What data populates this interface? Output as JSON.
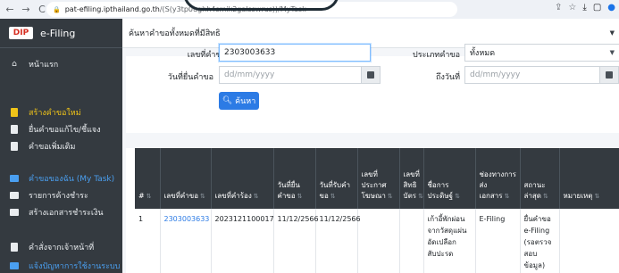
{
  "browser": {
    "url_host": "pat-efiling.ipthailand.go.th",
    "url_path": "/(S(y3tp0ughh4smik2galsswrus))/MyTask"
  },
  "sidebar": {
    "brand_logo": "DIP",
    "brand": "e-Filing",
    "items": [
      {
        "label": "หน้าแรก",
        "icon": "home-icon"
      },
      {
        "label": "สร้างคำขอใหม่",
        "icon": "document-icon"
      },
      {
        "label": "ยื่นคำขอแก้ไข/ชี้แจง",
        "icon": "document-icon"
      },
      {
        "label": "คำขอเพิ่มเติม",
        "icon": "document-icon"
      },
      {
        "label": "คำขอของฉัน (My Task)",
        "icon": "folder-icon"
      },
      {
        "label": "รายการค้างชำระ",
        "icon": "card-icon"
      },
      {
        "label": "สร้างเอกสารชำระเงิน",
        "icon": "card-icon"
      },
      {
        "label": "คำสั่งจากเจ้าหน้าที่",
        "icon": "document-icon"
      },
      {
        "label": "แจ้งปัญหาการใช้งานระบบ",
        "icon": "folder-icon"
      }
    ]
  },
  "page": {
    "title": "ค้นหาคำขอทั้งหมดที่มีสิทธิ"
  },
  "search": {
    "request_no_label": "เลขที่คำขอ",
    "request_no_value": "2303003633",
    "type_label": "ประเภทคำขอ",
    "type_value": "ทั้งหมด",
    "date_from_label": "วันที่ยื่นคำขอ",
    "date_from_placeholder": "dd/mm/yyyy",
    "date_to_label": "ถึงวันที่",
    "date_to_placeholder": "dd/mm/yyyy",
    "search_button": "ค้นหา"
  },
  "table": {
    "headers": [
      "#",
      "เลขที่คำขอ",
      "เลขที่คำร้อง",
      "วันที่ยื่นคำขอ",
      "วันที่รับคำขอ",
      "เลขที่ประกาศโฆษณา",
      "เลขที่สิทธิบัตร",
      "ชื่อการประดิษฐ์",
      "ช่องทางการส่งเอกสาร",
      "สถานะล่าสุด",
      "หมายเหตุ"
    ],
    "rows": [
      {
        "no": "1",
        "request_no": "2303003633",
        "petition_no": "2023121100017",
        "filing_date": "11/12/2566",
        "receipt_date": "11/12/2566",
        "publication_no": "",
        "patent_no": "",
        "title": "เก้าอี้พักผ่อนจากวัสดุแผ่นอัดเปลือกสับปะรด",
        "channel": "E-Filing",
        "status": "ยื่นคำขอ e-Filing (รอตรวจสอบข้อมูล)",
        "remark": ""
      }
    ]
  }
}
